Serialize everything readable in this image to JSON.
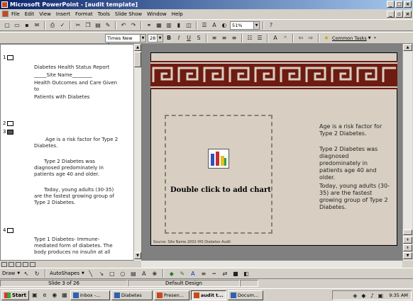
{
  "window": {
    "title": "Microsoft PowerPoint - [audit template]"
  },
  "menu": [
    "File",
    "Edit",
    "View",
    "Insert",
    "Format",
    "Tools",
    "Slide Show",
    "Window",
    "Help"
  ],
  "toolbar": {
    "zoom": "51%",
    "font": "Times New Roman",
    "font_size": "28",
    "common_tasks": "Common Tasks"
  },
  "outline": {
    "slides": [
      {
        "num": "1",
        "lines": [
          "Diabetes Health Status Report",
          "_____Site Name________",
          "Health Outcomes and Care Given",
          "to",
          "Patients with Diabetes"
        ]
      },
      {
        "num": "2",
        "lines": []
      },
      {
        "num": "3",
        "lines": [
          "Age is a risk factor for Type 2",
          "Diabetes.",
          "",
          "Type 2 Diabetes was",
          "diagnosed predominately in",
          "patients age 40 and older.",
          "",
          "Today, young adults (30-35)",
          "are the fastest growing group of",
          "Type 2 Diabetes."
        ]
      },
      {
        "num": "4",
        "lines": [
          "Type 1 Diabetes- Immune-",
          "mediated form of diabetes.  The",
          "body produces no insulin at all"
        ]
      }
    ]
  },
  "slide": {
    "placeholder_text": "Double click to add chart",
    "right_paragraphs": [
      "Age is a risk factor for Type 2 Diabetes.",
      "Type 2 Diabetes was diagnosed predominately in patients age 40 and older.",
      "Today, young adults (30-35) are the fastest growing group of Type 2 Diabetes."
    ],
    "footer": "Source: Site Name 2002 IHS Diabetes Audit"
  },
  "drawbar": {
    "draw": "Draw",
    "autoshapes": "AutoShapes"
  },
  "status": {
    "slide": "Slide 3 of 26",
    "design": "Default Design"
  },
  "taskbar": {
    "start": "Start",
    "tasks": [
      {
        "label": "Inbox -..."
      },
      {
        "label": "Diabetes"
      },
      {
        "label": "Presen..."
      },
      {
        "label": "audit t..."
      },
      {
        "label": "Docum..."
      }
    ],
    "time": "9:35 AM"
  }
}
